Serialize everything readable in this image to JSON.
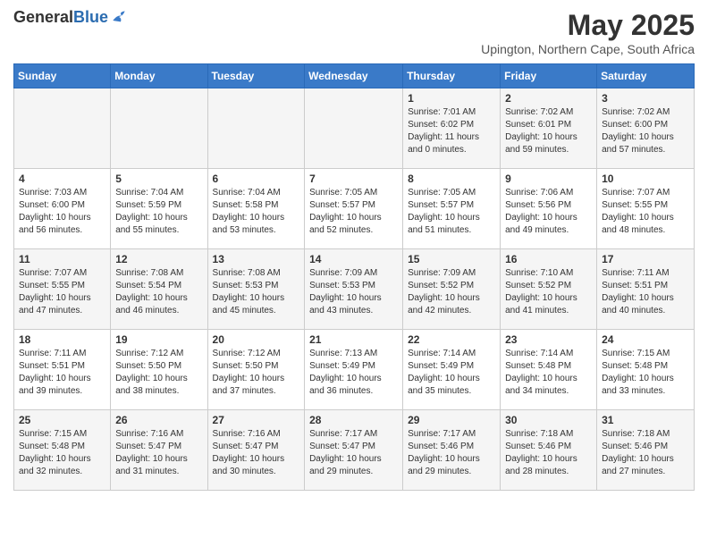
{
  "header": {
    "logo_general": "General",
    "logo_blue": "Blue",
    "title": "May 2025",
    "subtitle": "Upington, Northern Cape, South Africa"
  },
  "days_of_week": [
    "Sunday",
    "Monday",
    "Tuesday",
    "Wednesday",
    "Thursday",
    "Friday",
    "Saturday"
  ],
  "weeks": [
    [
      {
        "day": "",
        "info": ""
      },
      {
        "day": "",
        "info": ""
      },
      {
        "day": "",
        "info": ""
      },
      {
        "day": "",
        "info": ""
      },
      {
        "day": "1",
        "info": "Sunrise: 7:01 AM\nSunset: 6:02 PM\nDaylight: 11 hours\nand 0 minutes."
      },
      {
        "day": "2",
        "info": "Sunrise: 7:02 AM\nSunset: 6:01 PM\nDaylight: 10 hours\nand 59 minutes."
      },
      {
        "day": "3",
        "info": "Sunrise: 7:02 AM\nSunset: 6:00 PM\nDaylight: 10 hours\nand 57 minutes."
      }
    ],
    [
      {
        "day": "4",
        "info": "Sunrise: 7:03 AM\nSunset: 6:00 PM\nDaylight: 10 hours\nand 56 minutes."
      },
      {
        "day": "5",
        "info": "Sunrise: 7:04 AM\nSunset: 5:59 PM\nDaylight: 10 hours\nand 55 minutes."
      },
      {
        "day": "6",
        "info": "Sunrise: 7:04 AM\nSunset: 5:58 PM\nDaylight: 10 hours\nand 53 minutes."
      },
      {
        "day": "7",
        "info": "Sunrise: 7:05 AM\nSunset: 5:57 PM\nDaylight: 10 hours\nand 52 minutes."
      },
      {
        "day": "8",
        "info": "Sunrise: 7:05 AM\nSunset: 5:57 PM\nDaylight: 10 hours\nand 51 minutes."
      },
      {
        "day": "9",
        "info": "Sunrise: 7:06 AM\nSunset: 5:56 PM\nDaylight: 10 hours\nand 49 minutes."
      },
      {
        "day": "10",
        "info": "Sunrise: 7:07 AM\nSunset: 5:55 PM\nDaylight: 10 hours\nand 48 minutes."
      }
    ],
    [
      {
        "day": "11",
        "info": "Sunrise: 7:07 AM\nSunset: 5:55 PM\nDaylight: 10 hours\nand 47 minutes."
      },
      {
        "day": "12",
        "info": "Sunrise: 7:08 AM\nSunset: 5:54 PM\nDaylight: 10 hours\nand 46 minutes."
      },
      {
        "day": "13",
        "info": "Sunrise: 7:08 AM\nSunset: 5:53 PM\nDaylight: 10 hours\nand 45 minutes."
      },
      {
        "day": "14",
        "info": "Sunrise: 7:09 AM\nSunset: 5:53 PM\nDaylight: 10 hours\nand 43 minutes."
      },
      {
        "day": "15",
        "info": "Sunrise: 7:09 AM\nSunset: 5:52 PM\nDaylight: 10 hours\nand 42 minutes."
      },
      {
        "day": "16",
        "info": "Sunrise: 7:10 AM\nSunset: 5:52 PM\nDaylight: 10 hours\nand 41 minutes."
      },
      {
        "day": "17",
        "info": "Sunrise: 7:11 AM\nSunset: 5:51 PM\nDaylight: 10 hours\nand 40 minutes."
      }
    ],
    [
      {
        "day": "18",
        "info": "Sunrise: 7:11 AM\nSunset: 5:51 PM\nDaylight: 10 hours\nand 39 minutes."
      },
      {
        "day": "19",
        "info": "Sunrise: 7:12 AM\nSunset: 5:50 PM\nDaylight: 10 hours\nand 38 minutes."
      },
      {
        "day": "20",
        "info": "Sunrise: 7:12 AM\nSunset: 5:50 PM\nDaylight: 10 hours\nand 37 minutes."
      },
      {
        "day": "21",
        "info": "Sunrise: 7:13 AM\nSunset: 5:49 PM\nDaylight: 10 hours\nand 36 minutes."
      },
      {
        "day": "22",
        "info": "Sunrise: 7:14 AM\nSunset: 5:49 PM\nDaylight: 10 hours\nand 35 minutes."
      },
      {
        "day": "23",
        "info": "Sunrise: 7:14 AM\nSunset: 5:48 PM\nDaylight: 10 hours\nand 34 minutes."
      },
      {
        "day": "24",
        "info": "Sunrise: 7:15 AM\nSunset: 5:48 PM\nDaylight: 10 hours\nand 33 minutes."
      }
    ],
    [
      {
        "day": "25",
        "info": "Sunrise: 7:15 AM\nSunset: 5:48 PM\nDaylight: 10 hours\nand 32 minutes."
      },
      {
        "day": "26",
        "info": "Sunrise: 7:16 AM\nSunset: 5:47 PM\nDaylight: 10 hours\nand 31 minutes."
      },
      {
        "day": "27",
        "info": "Sunrise: 7:16 AM\nSunset: 5:47 PM\nDaylight: 10 hours\nand 30 minutes."
      },
      {
        "day": "28",
        "info": "Sunrise: 7:17 AM\nSunset: 5:47 PM\nDaylight: 10 hours\nand 29 minutes."
      },
      {
        "day": "29",
        "info": "Sunrise: 7:17 AM\nSunset: 5:46 PM\nDaylight: 10 hours\nand 29 minutes."
      },
      {
        "day": "30",
        "info": "Sunrise: 7:18 AM\nSunset: 5:46 PM\nDaylight: 10 hours\nand 28 minutes."
      },
      {
        "day": "31",
        "info": "Sunrise: 7:18 AM\nSunset: 5:46 PM\nDaylight: 10 hours\nand 27 minutes."
      }
    ]
  ]
}
